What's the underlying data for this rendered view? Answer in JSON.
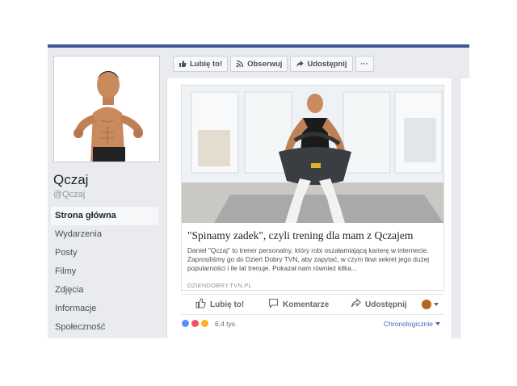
{
  "page": {
    "name": "Qczaj",
    "handle": "@Qczaj"
  },
  "nav": {
    "items": [
      {
        "label": "Strona główna",
        "active": true
      },
      {
        "label": "Wydarzenia"
      },
      {
        "label": "Posty"
      },
      {
        "label": "Filmy"
      },
      {
        "label": "Zdjęcia"
      },
      {
        "label": "Informacje"
      },
      {
        "label": "Społeczność"
      }
    ]
  },
  "actions": {
    "like": "Lubię to!",
    "follow": "Obserwuj",
    "share": "Udostępnij",
    "more": "···"
  },
  "post": {
    "title": "\"Spinamy zadek\", czyli trening dla mam z Qczajem",
    "description": "Daniel \"Qczaj\" to trener personalny, który robi oszałamiającą karierę w internecie. Zaprosiliśmy go do Dzień Dobry TVN, aby zapytać, w czym tkwi sekret jego dużej popularności i ile lat trenuje. Pokazał nam również kilka...",
    "domain": "DZIENDOBRY.TVN.PL",
    "like_label": "Lubię to!",
    "comment_label": "Komentarze",
    "share_label": "Udostępnij",
    "reaction_count": "6,4 tys.",
    "sort_label": "Chronologicznie"
  },
  "colors": {
    "brand": "#3b5998",
    "link": "#4267b2",
    "background": "#e9ebee"
  },
  "icons": [
    "thumbs-up-icon",
    "rss-icon",
    "share-arrow-icon",
    "more-icon",
    "comment-icon",
    "caret-down-icon"
  ]
}
